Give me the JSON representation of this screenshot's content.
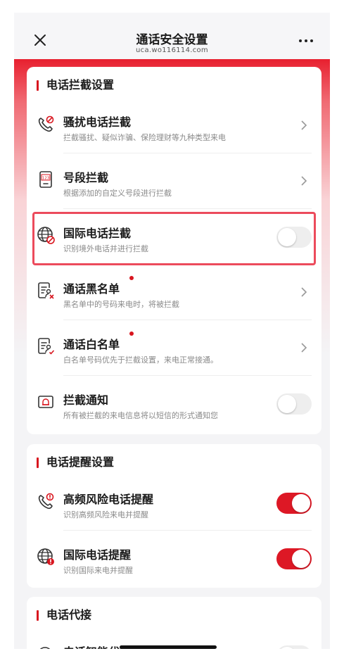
{
  "header": {
    "title": "通话安全设置",
    "subtitle": "uca.wo116114.com"
  },
  "sections": [
    {
      "title": "电话拦截设置",
      "items": [
        {
          "name": "骚扰电话拦截",
          "desc": "拦截骚扰、疑似诈骗、保险理财等九种类型来电",
          "control": "chevron"
        },
        {
          "name": "号段拦截",
          "desc": "根据添加的自定义号段进行拦截",
          "control": "chevron",
          "icon_text": "123"
        },
        {
          "name": "国际电话拦截",
          "desc": "识别境外电话并进行拦截",
          "control": "toggle",
          "on": false,
          "highlighted": true
        },
        {
          "name": "通话黑名单",
          "desc": "黑名单中的号码来电时，将被拦截",
          "control": "chevron",
          "badge": true
        },
        {
          "name": "通话白名单",
          "desc": "白名单号码优先于拦截设置，来电正常接通。",
          "control": "chevron",
          "badge": true
        },
        {
          "name": "拦截通知",
          "desc": "所有被拦截的来电信息将以短信的形式通知您",
          "control": "toggle",
          "on": false
        }
      ]
    },
    {
      "title": "电话提醒设置",
      "items": [
        {
          "name": "高频风险电话提醒",
          "desc": "识别高频风险来电并提醒",
          "control": "toggle",
          "on": true
        },
        {
          "name": "国际电话提醒",
          "desc": "识别国际来电并提醒",
          "control": "toggle",
          "on": true
        }
      ]
    },
    {
      "title": "电话代接",
      "items": [
        {
          "name": "电话智能代接",
          "control": "toggle",
          "on": false
        }
      ]
    }
  ],
  "colors": {
    "accent": "#dd1825",
    "highlight": "#ec4b5c"
  },
  "icons": [
    "close-icon",
    "more-icon",
    "phone-block-icon",
    "number-segment-icon",
    "globe-block-icon",
    "blacklist-icon",
    "whitelist-icon",
    "bell-notice-icon",
    "phone-alert-icon",
    "globe-alert-icon",
    "chevron-right-icon"
  ]
}
